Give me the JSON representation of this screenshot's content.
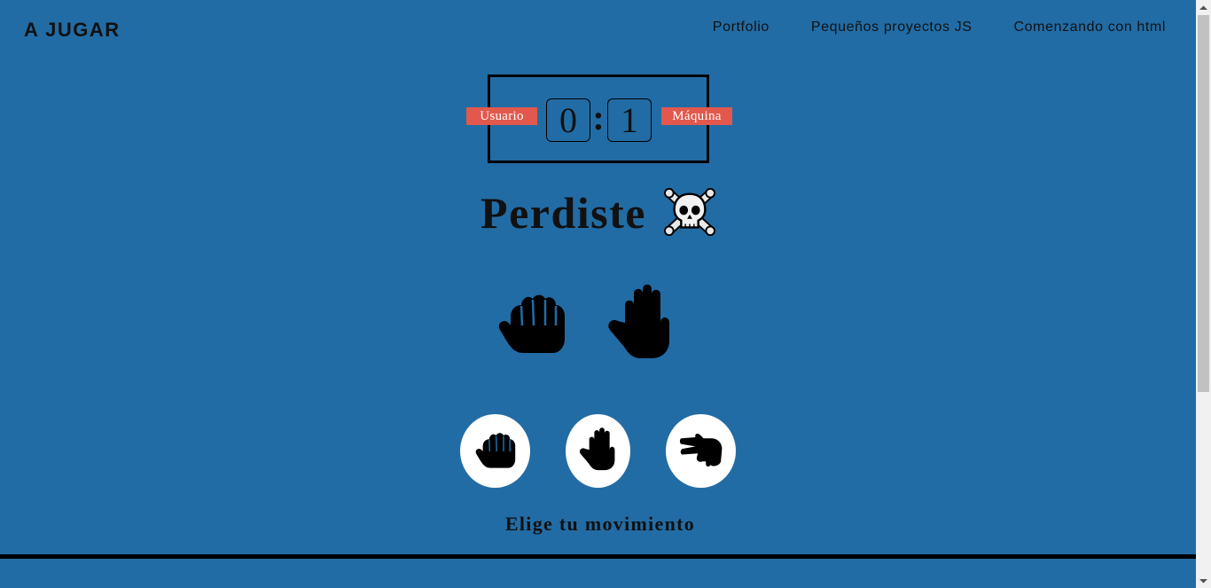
{
  "header": {
    "logo": "A JUGAR",
    "nav": [
      {
        "label": "Portfolio"
      },
      {
        "label": "Pequeños proyectos JS"
      },
      {
        "label": "Comenzando con html"
      }
    ]
  },
  "scoreboard": {
    "user_label": "Usuario",
    "machine_label": "Máquina",
    "user_score": "0",
    "separator": ":",
    "machine_score": "1"
  },
  "result": {
    "text": "Perdiste",
    "icon": "skull-and-crossbones-icon"
  },
  "played": {
    "user_move": "rock",
    "machine_move": "paper"
  },
  "options": [
    {
      "move": "rock",
      "icon": "fist-icon"
    },
    {
      "move": "paper",
      "icon": "open-hand-icon"
    },
    {
      "move": "scissors",
      "icon": "scissors-hand-icon"
    }
  ],
  "instruction": "Elige tu movimiento",
  "colors": {
    "background": "#226ca5",
    "tag": "#e2584d",
    "text": "#111111"
  }
}
